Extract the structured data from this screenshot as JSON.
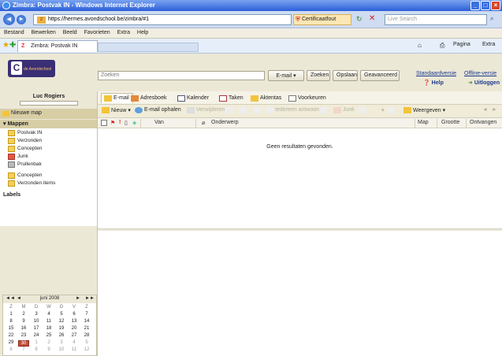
{
  "window": {
    "title": "Zimbra: Postvak IN - Windows Internet Explorer"
  },
  "browser": {
    "url": "https://hermes.avondschool.be/zimbra/#1",
    "cert_label": "Certificaatfout",
    "search_placeholder": "Live Search",
    "menu": [
      "Bestand",
      "Bewerken",
      "Beeld",
      "Favorieten",
      "Extra",
      "Help"
    ],
    "tab_label": "Zimbra: Postvak IN",
    "toolbar_right": [
      "Pagina",
      "Extra"
    ]
  },
  "zimbra": {
    "logo_text": "de Avondschool",
    "search_placeholder": "Zoeken",
    "search_type": "E-mail",
    "search_button": "Zoeken",
    "save_button": "Opslaan",
    "advanced_button": "Geavanceerd",
    "standard_version": "Standaardversie",
    "offline_version": "Offline-versie",
    "help": "Help",
    "logout": "Uitloggen",
    "user_name": "Luc Rogiers",
    "new_folder": "Nieuwe map",
    "folders_section": "Mappen",
    "folders": [
      "Postvak IN",
      "Verzonden",
      "Concepten",
      "Junk",
      "Prullenbak"
    ],
    "extra_folders": [
      "Concepten",
      "Verzonden items"
    ],
    "labels_section": "Labels",
    "app_tabs": [
      "E-mail",
      "Adresboek",
      "Kalender",
      "Taken",
      "Aktentas",
      "Voorkeuren"
    ],
    "toolbar": {
      "new": "Nieuw",
      "get_mail": "E-mail ophalen",
      "delete": "Verwijderen",
      "reply_all": "Iedereen antwoorden",
      "junk": "Junk",
      "view": "Weergeven"
    },
    "list_columns": {
      "from": "Van",
      "subject": "Onderwerp",
      "folder": "Map",
      "size": "Grootte",
      "received": "Ontvangen"
    },
    "empty_message": "Geen resultaten gevonden."
  },
  "calendar": {
    "month_label": "juni 2008",
    "weekday_headers": [
      "Z",
      "M",
      "D",
      "W",
      "D",
      "V",
      "Z"
    ],
    "weeks": [
      [
        "1",
        "2",
        "3",
        "4",
        "5",
        "6",
        "7"
      ],
      [
        "8",
        "9",
        "10",
        "11",
        "12",
        "13",
        "14"
      ],
      [
        "15",
        "16",
        "17",
        "18",
        "19",
        "20",
        "21"
      ],
      [
        "22",
        "23",
        "24",
        "25",
        "26",
        "27",
        "28"
      ],
      [
        "29",
        "30",
        "1",
        "2",
        "3",
        "4",
        "5"
      ],
      [
        "6",
        "7",
        "8",
        "9",
        "10",
        "11",
        "12"
      ]
    ],
    "today": "30"
  },
  "colors": {
    "titlebar": "#2a5fd8",
    "zimbra_bg": "#ece8d6",
    "selected_folder": "#d8cea5",
    "today": "#c34f3b"
  }
}
